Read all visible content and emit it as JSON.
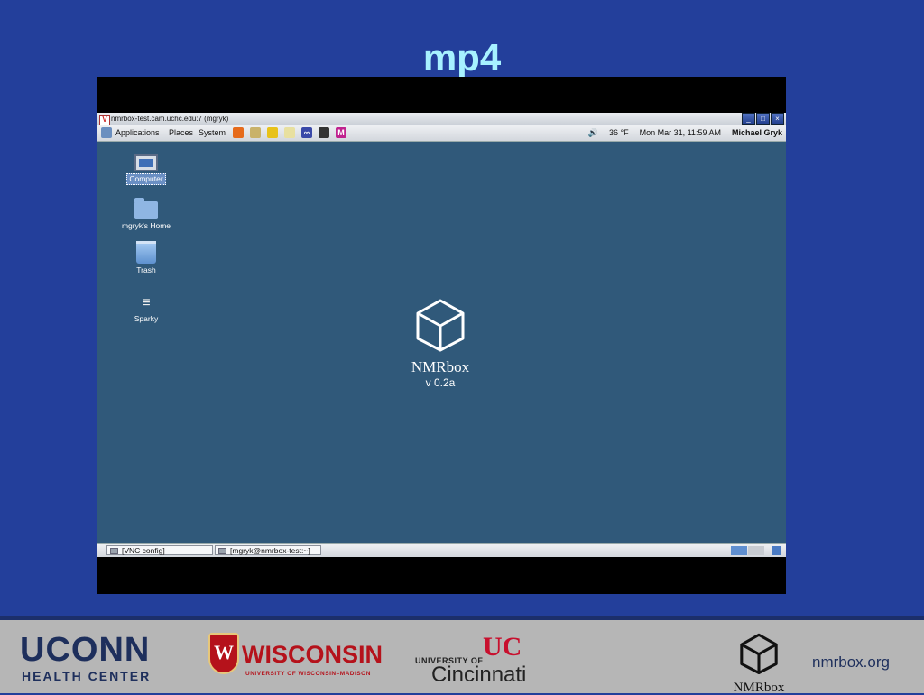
{
  "slide": {
    "title": "mp4"
  },
  "window": {
    "title": "nmrbox-test.cam.uchc.edu:7 (mgryk)",
    "vnc_logo": "V",
    "buttons": {
      "minimize": "_",
      "maximize": "□",
      "close": "×"
    }
  },
  "top_panel": {
    "menus": [
      "Applications",
      "Places",
      "System"
    ],
    "launchers": [
      {
        "name": "firefox-icon",
        "color": "#e66b1c"
      },
      {
        "name": "email-icon",
        "color": "#c9b26a"
      },
      {
        "name": "notes-icon",
        "color": "#e8c21a"
      },
      {
        "name": "editor-icon",
        "color": "#e8e0a0"
      },
      {
        "name": "link-icon",
        "color": "#3a49a8",
        "glyph": "∞"
      },
      {
        "name": "terminal-icon",
        "color": "#333333"
      },
      {
        "name": "m-app-icon",
        "color": "#c0238f",
        "glyph": "M"
      }
    ],
    "volume_glyph": "🔊",
    "weather": "36 °F",
    "datetime": "Mon Mar 31, 11:59 AM",
    "user": "Michael Gryk"
  },
  "desktop": {
    "icons": [
      {
        "label": "Computer"
      },
      {
        "label": "mgryk's Home"
      },
      {
        "label": "Trash"
      },
      {
        "label": "Sparky"
      }
    ],
    "logo_name": "NMRbox",
    "logo_version": "v 0.2a"
  },
  "bottom_panel": {
    "tasks": [
      "[VNC config]",
      "[mgryk@nmrbox-test:~]"
    ]
  },
  "footer": {
    "uconn_line1": "UCONN",
    "uconn_line2": "HEALTH CENTER",
    "wisc_crest": "W",
    "wisc_line1": "WISCONSIN",
    "wisc_line2": "UNIVERSITY OF WISCONSIN–MADISON",
    "uc_line1": "UNIVERSITY OF",
    "uc_line2": "Cincinnati",
    "uc_mark": "UC",
    "nmrbox_logo": "NMRbox",
    "url": "nmrbox.org"
  },
  "colors": {
    "background": "#233f9b",
    "title": "#a7f1ff",
    "desktop": "#30597a",
    "footer": "#b6b6b6"
  }
}
